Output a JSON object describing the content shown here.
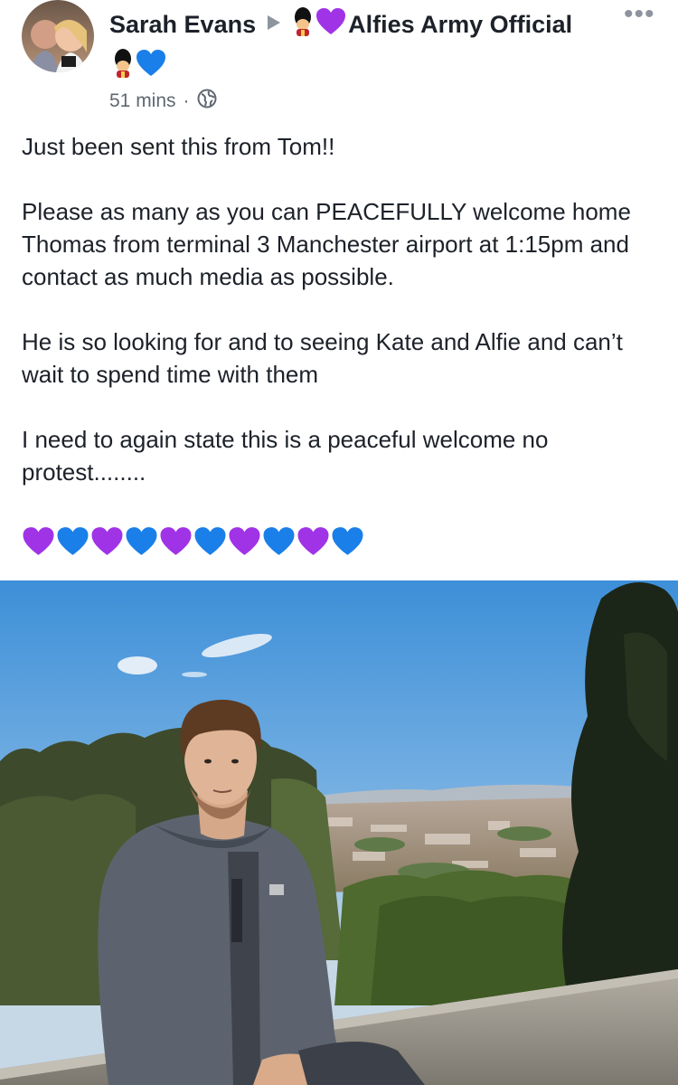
{
  "post": {
    "author": "Sarah Evans",
    "group": "Alfies Army Official",
    "time": "51 mins",
    "separator": "·",
    "more": "•••",
    "paragraphs": [
      "Just been sent this from Tom!!",
      "Please as many as you can PEACEFULLY welcome home Thomas from terminal 3 Manchester airport at 1:15pm and contact as much media as possible.",
      "He is so looking for and to seeing Kate and Alfie and can’t wait to spend time with them",
      "I need to again state this is a peaceful welcome no protest........"
    ],
    "hearts": [
      "purple-heart",
      "blue-heart",
      "purple-heart",
      "blue-heart",
      "purple-heart",
      "blue-heart",
      "purple-heart",
      "blue-heart",
      "purple-heart",
      "blue-heart"
    ]
  },
  "colors": {
    "text": "#1d2129",
    "meta": "#606770",
    "purple_heart": "#a033e6",
    "blue_heart": "#1a7fe8"
  },
  "icons": [
    "avatar",
    "play-arrow-icon",
    "guard-icon",
    "purple-heart-icon",
    "blue-heart-icon",
    "globe-icon",
    "more-icon"
  ]
}
